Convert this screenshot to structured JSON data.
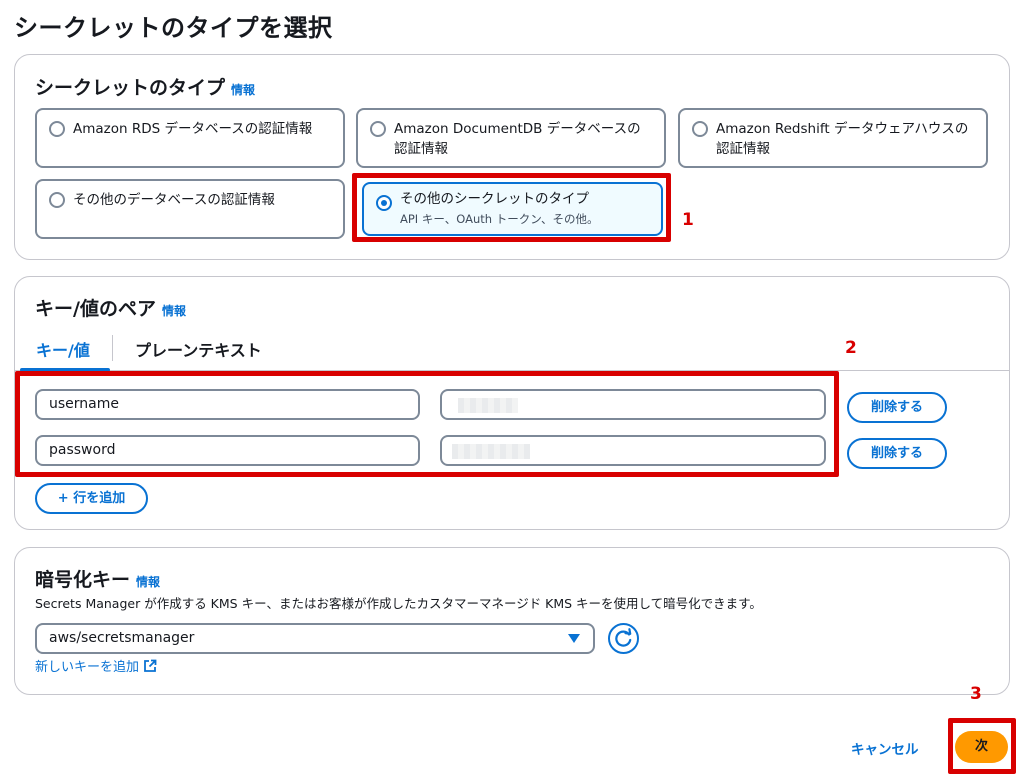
{
  "page": {
    "title": "シークレットのタイプを選択"
  },
  "secret_type_panel": {
    "title": "シークレットのタイプ",
    "info": "情報",
    "options": [
      {
        "label": "Amazon RDS データベースの認証情報",
        "selected": false
      },
      {
        "label": "Amazon DocumentDB データベースの認証情報",
        "selected": false
      },
      {
        "label": "Amazon Redshift データウェアハウスの認証情報",
        "selected": false
      },
      {
        "label": "その他のデータベースの認証情報",
        "selected": false
      },
      {
        "label": "その他のシークレットのタイプ",
        "sublabel": "API キー、OAuth トークン、その他。",
        "selected": true
      }
    ]
  },
  "kv_panel": {
    "title": "キー/値のペア",
    "info": "情報",
    "tabs": [
      {
        "label": "キー/値",
        "active": true
      },
      {
        "label": "プレーンテキスト",
        "active": false
      }
    ],
    "rows": [
      {
        "key": "username",
        "remove_label": "削除する"
      },
      {
        "key": "password",
        "remove_label": "削除する"
      }
    ],
    "add_row_label": "+ 行を追加"
  },
  "encryption_panel": {
    "title": "暗号化キー",
    "info": "情報",
    "description": "Secrets Manager が作成する KMS キー、またはお客様が作成したカスタマーマネージド KMS キーを使用して暗号化できます。",
    "selected_key": "aws/secretsmanager",
    "add_key_link": "新しいキーを追加"
  },
  "footer": {
    "cancel_label": "キャンセル",
    "next_label": "次"
  },
  "annotations": {
    "step1": "1",
    "step2": "2",
    "step3": "3"
  },
  "colors": {
    "accent": "#0972d3",
    "primary_button": "#ff9900",
    "annotation": "#d80000"
  },
  "icons": {
    "radio": "radio-icon",
    "dropdown": "caret-down-icon",
    "refresh": "refresh-icon",
    "external": "external-link-icon"
  }
}
